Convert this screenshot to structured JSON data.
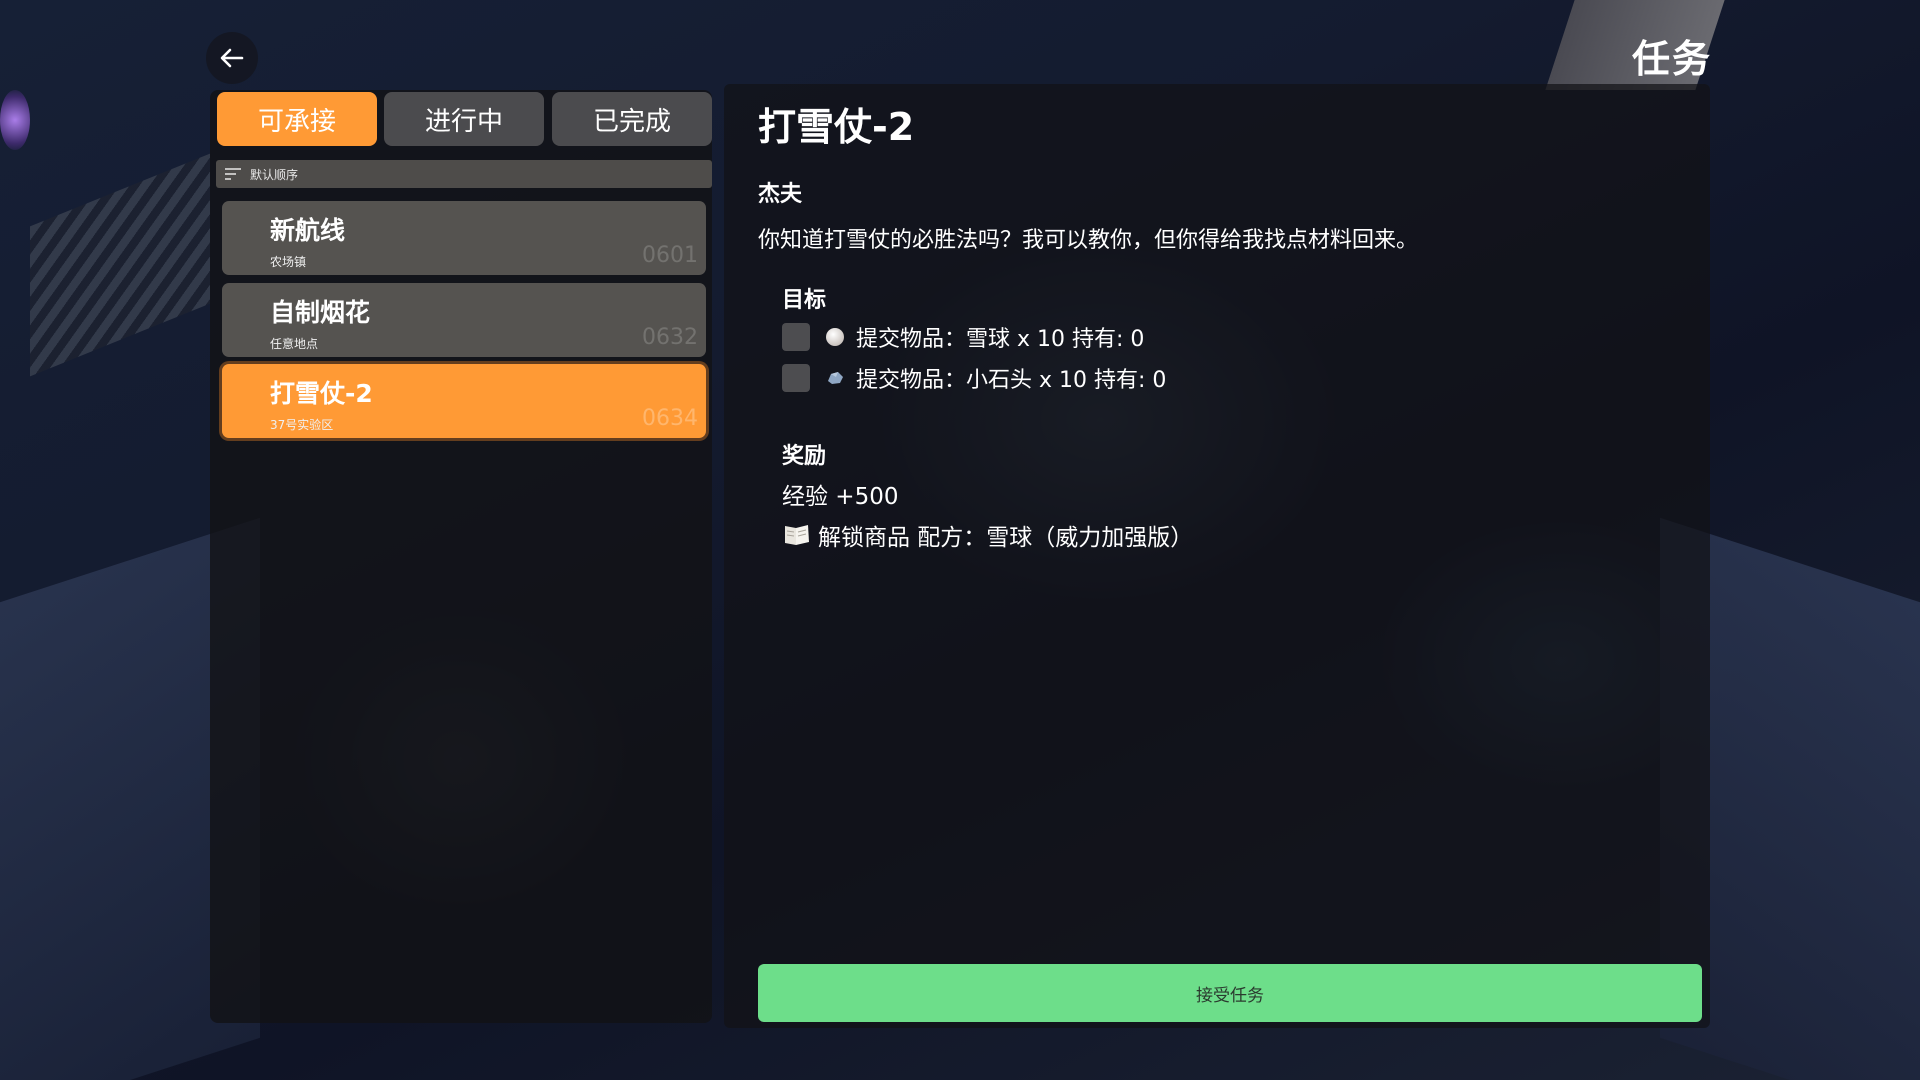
{
  "header": {
    "title": "任务"
  },
  "tabs": [
    {
      "label": "可承接",
      "active": true
    },
    {
      "label": "进行中",
      "active": false
    },
    {
      "label": "已完成",
      "active": false
    }
  ],
  "sort": {
    "label": "默认顺序"
  },
  "quests": [
    {
      "title": "新航线",
      "location": "农场镇",
      "id": "0601",
      "selected": false
    },
    {
      "title": "自制烟花",
      "location": "任意地点",
      "id": "0632",
      "selected": false
    },
    {
      "title": "打雪仗-2",
      "location": "37号实验区",
      "id": "0634",
      "selected": true
    }
  ],
  "detail": {
    "title": "打雪仗-2",
    "npc": "杰夫",
    "dialogue": "你知道打雪仗的必胜法吗？我可以教你，但你得给我找点材料回来。",
    "objectives_label": "目标",
    "objectives": [
      {
        "text": "提交物品：雪球 x 10 持有: 0",
        "icon": "snowball-icon",
        "done": false
      },
      {
        "text": "提交物品：小石头 x 10 持有: 0",
        "icon": "stone-icon",
        "done": false
      }
    ],
    "rewards_label": "奖励",
    "rewards": [
      {
        "text": "经验 +500",
        "icon": ""
      },
      {
        "text": "解锁商品 配方：雪球（威力加强版）",
        "icon": "recipe-book-icon"
      }
    ]
  },
  "accept_button": {
    "label": "接受任务"
  },
  "colors": {
    "accent": "#ff9a35",
    "tab_inactive": "#4b4b4e",
    "accept": "#6dde8a"
  }
}
